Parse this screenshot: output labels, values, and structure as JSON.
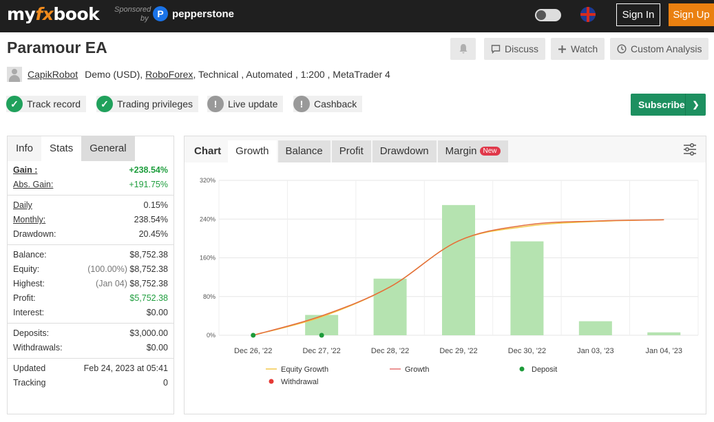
{
  "topbar": {
    "logo_pre": "my",
    "logo_fx": "fx",
    "logo_post": "book",
    "sponsored_label": "Sponsored",
    "sponsored_by": "by",
    "sponsor_name": "pepperstone",
    "signin_label": "Sign In",
    "signup_label": "Sign Up"
  },
  "header": {
    "title": "Paramour EA",
    "discuss_label": "Discuss",
    "watch_label": "Watch",
    "custom_label": "Custom Analysis"
  },
  "account": {
    "user": "CapikRobot",
    "type": "Demo (USD),",
    "broker": "RoboForex",
    "details": ", Technical , Automated , 1:200 , MetaTrader 4"
  },
  "badges": [
    {
      "label": "Track record",
      "status": "ok"
    },
    {
      "label": "Trading privileges",
      "status": "ok"
    },
    {
      "label": "Live update",
      "status": "warn"
    },
    {
      "label": "Cashback",
      "status": "warn"
    }
  ],
  "subscribe_label": "Subscribe",
  "left_tabs": [
    "Info",
    "Stats",
    "General"
  ],
  "stats": {
    "gain_label": "Gain :",
    "gain": "+238.54%",
    "abs_gain_label": "Abs. Gain:",
    "abs_gain": "+191.75%",
    "daily_label": "Daily",
    "daily": "0.15%",
    "monthly_label": "Monthly:",
    "monthly": "238.54%",
    "drawdown_label": "Drawdown:",
    "drawdown": "20.45%",
    "balance_label": "Balance:",
    "balance": "$8,752.38",
    "equity_label": "Equity:",
    "equity_pct": "(100.00%)",
    "equity": "$8,752.38",
    "highest_label": "Highest:",
    "highest_date": "(Jan 04)",
    "highest": "$8,752.38",
    "profit_label": "Profit:",
    "profit": "$5,752.38",
    "interest_label": "Interest:",
    "interest": "$0.00",
    "deposits_label": "Deposits:",
    "deposits": "$3,000.00",
    "withdrawals_label": "Withdrawals:",
    "withdrawals": "$0.00",
    "updated_label": "Updated",
    "updated": "Feb 24, 2023 at 05:41",
    "tracking_label": "Tracking",
    "tracking": "0"
  },
  "chart_tabs": {
    "static": "Chart",
    "tabs": [
      "Growth",
      "Balance",
      "Profit",
      "Drawdown",
      "Margin"
    ],
    "new_badge": "New"
  },
  "chart_data": {
    "type": "bar",
    "categories": [
      "Dec 26, '22",
      "Dec 27, '22",
      "Dec 28, '22",
      "Dec 29, '22",
      "Dec 30, '22",
      "Jan 03, '23",
      "Jan 04, '23"
    ],
    "ylim": [
      0,
      320
    ],
    "yticks": [
      "0%",
      "80%",
      "160%",
      "240%",
      "320%"
    ],
    "ytick_values": [
      0,
      80,
      160,
      240,
      320
    ],
    "series": [
      {
        "name": "Growth",
        "kind": "bar",
        "color": "#b5e3b0",
        "values": [
          0,
          42,
          117,
          269,
          194,
          29,
          6
        ]
      },
      {
        "name": "Equity Growth",
        "kind": "line",
        "color": "#f2c84b",
        "values": [
          0,
          38,
          100,
          195,
          225,
          235,
          238.5
        ]
      },
      {
        "name": "Growth",
        "kind": "line",
        "color": "#e36d3d",
        "values": [
          0,
          40,
          100,
          195,
          228,
          236,
          238.5
        ]
      }
    ],
    "deposits": [
      "Dec 26, '22",
      "Dec 27, '22"
    ],
    "legend": [
      {
        "name": "Equity Growth",
        "kind": "line",
        "color": "#f2c84b"
      },
      {
        "name": "Growth",
        "kind": "line",
        "color": "#e57373"
      },
      {
        "name": "Deposit",
        "kind": "dot",
        "color": "#1d9b3a"
      },
      {
        "name": "Withdrawal",
        "kind": "dot",
        "color": "#e53935"
      }
    ]
  }
}
